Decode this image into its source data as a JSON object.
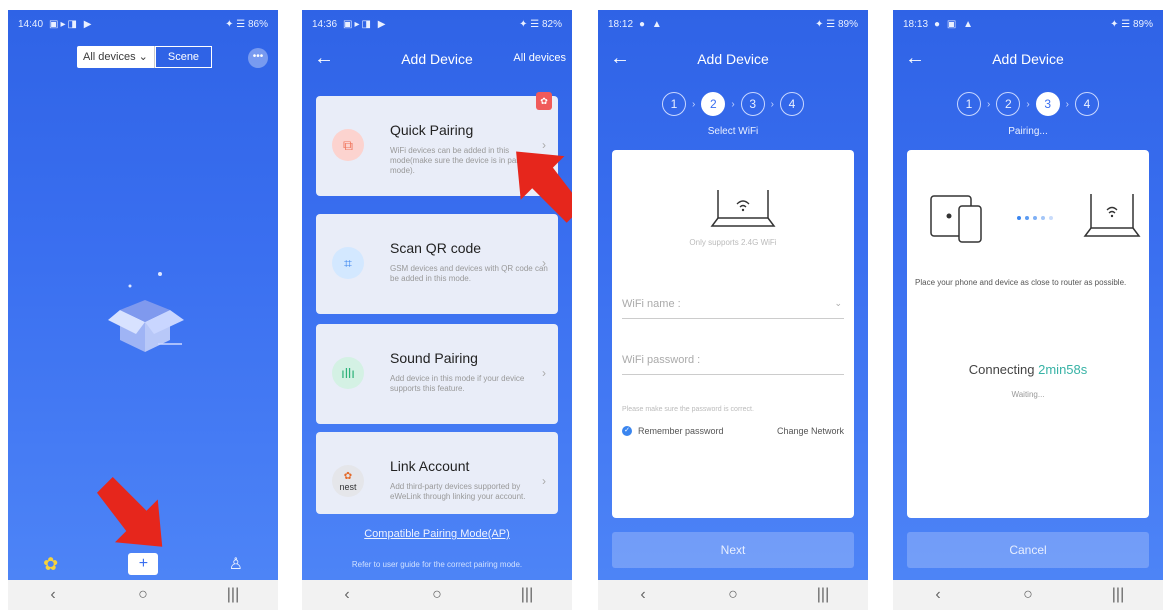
{
  "colors": {
    "primary": "#3a6ff0",
    "accent_red": "#e6261c",
    "teal": "#38b3a6"
  },
  "phone1": {
    "time": "14:40",
    "battery": "86%",
    "segment": {
      "all_devices": "All devices",
      "scene": "Scene"
    },
    "more": "•••",
    "tab_icons": [
      "grid-icon",
      "plus-icon",
      "user-icon"
    ],
    "plus": "+"
  },
  "phone2": {
    "time": "14:36",
    "battery": "82%",
    "title": "Add Device",
    "right": "All devices",
    "cards": [
      {
        "title": "Quick Pairing",
        "desc": "WiFi devices can be added in this mode(make sure the device is in pairing mode).",
        "icon": "device-icon"
      },
      {
        "title": "Scan QR code",
        "desc": "GSM devices and devices with QR code can be added in this mode.",
        "icon": "qr-icon"
      },
      {
        "title": "Sound Pairing",
        "desc": "Add device in this mode if your device supports this feature.",
        "icon": "sound-icon"
      },
      {
        "title": "Link Account",
        "desc": "Add third-party devices supported by eWeLink through linking your account.",
        "icon": "nest-icon",
        "logo_text": "nest"
      }
    ],
    "compatible": "Compatible Pairing Mode(AP)",
    "refer": "Refer to user guide for the correct pairing mode."
  },
  "phone3": {
    "time": "18:12",
    "battery": "89%",
    "title": "Add Device",
    "steps": [
      "1",
      "2",
      "3",
      "4"
    ],
    "active_step": 2,
    "step_label": "Select WiFi",
    "support": "Only supports 2.4G WiFi",
    "wifi_name_placeholder": "WiFi name :",
    "wifi_password_placeholder": "WiFi password :",
    "hint": "Please make sure the password is correct.",
    "remember": "Remember password",
    "change": "Change Network",
    "next": "Next"
  },
  "phone4": {
    "time": "18:13",
    "battery": "89%",
    "title": "Add Device",
    "steps": [
      "1",
      "2",
      "3",
      "4"
    ],
    "active_step": 3,
    "step_label": "Pairing...",
    "place": "Place your phone and device as close to router as possible.",
    "connecting": "Connecting",
    "time_left": "2min58s",
    "waiting": "Waiting...",
    "cancel": "Cancel"
  }
}
